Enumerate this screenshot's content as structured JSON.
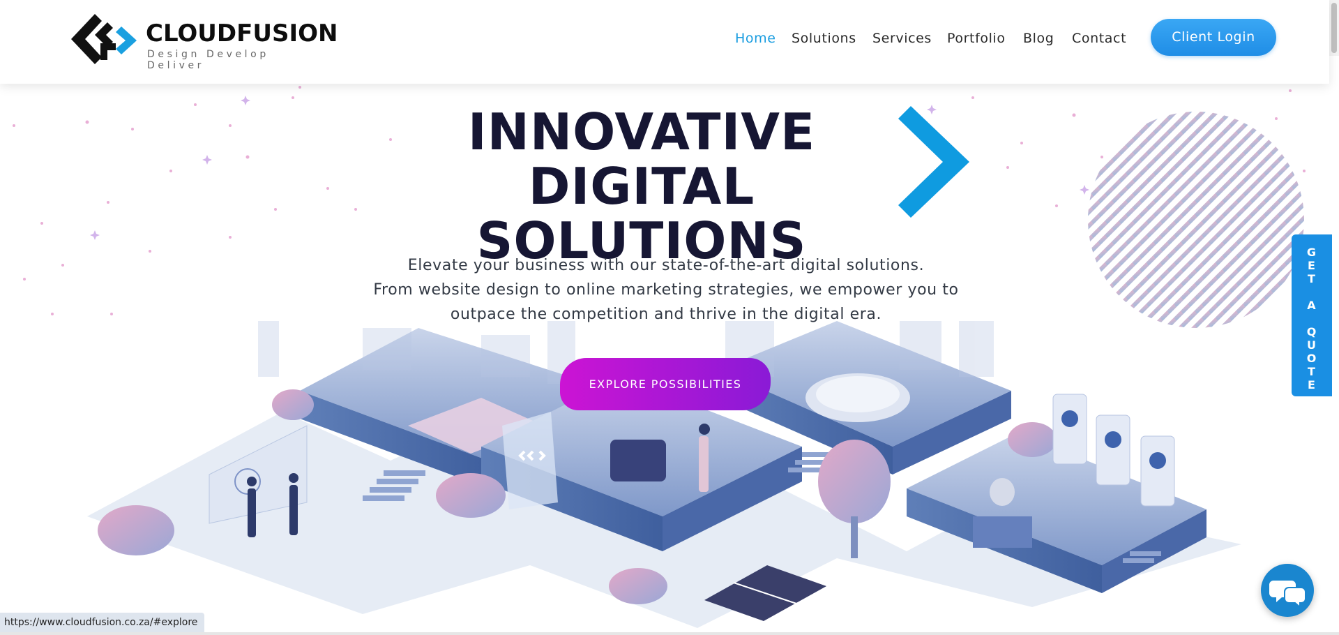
{
  "header": {
    "logo": {
      "name": "CLOUDFUSION",
      "tagline": "Design Develop Deliver"
    },
    "nav": [
      {
        "label": "Home",
        "active": true
      },
      {
        "label": "Solutions",
        "active": false
      },
      {
        "label": "Services",
        "active": false
      },
      {
        "label": "Portfolio",
        "active": false
      },
      {
        "label": "Blog",
        "active": false
      },
      {
        "label": "Contact",
        "active": false
      }
    ],
    "login_label": "Client Login"
  },
  "hero": {
    "title_line1": "INNOVATIVE DIGITAL",
    "title_line2": "SOLUTIONS",
    "subtitle_line1": "Elevate your business with our state-of-the-art digital solutions.",
    "subtitle_line2": "From website design to online marketing strategies, we empower you to",
    "subtitle_line3": "outpace the competition and thrive in the digital era.",
    "cta_label": "EXPLORE POSSIBILITIES"
  },
  "side_tab": {
    "label": "GET A QUOTE"
  },
  "chat": {
    "icon": "chat-bubbles-icon"
  },
  "status_bar": {
    "url": "https://www.cloudfusion.co.za/#explore"
  },
  "colors": {
    "accent_blue": "#1a9de0",
    "title_navy": "#161633",
    "cta_magenta": "#cc14d4",
    "cta_purple": "#8a1ad6",
    "quote_blue": "#1a8fe3"
  }
}
